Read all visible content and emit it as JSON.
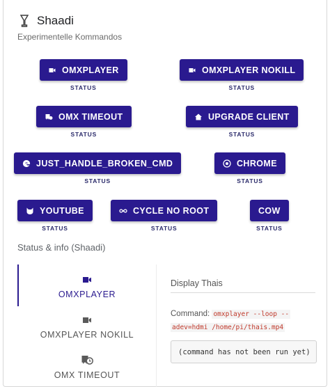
{
  "header": {
    "icon": "cocktail-glass-icon",
    "title": "Shaadi",
    "subtitle": "Experimentelle Kommandos"
  },
  "commands": [
    {
      "label": "OMXPLAYER",
      "status": "STATUS",
      "icon": "video-camera-icon"
    },
    {
      "label": "OMXPLAYER NOKILL",
      "status": "STATUS",
      "icon": "video-camera-icon"
    },
    {
      "label": "OMX TIMEOUT",
      "status": "STATUS",
      "icon": "bus-clock-icon"
    },
    {
      "label": "UPGRADE CLIENT",
      "status": "STATUS",
      "icon": "home-icon"
    },
    {
      "label": "JUST_HANDLE_BROKEN_CMD",
      "status": "STATUS",
      "icon": "edge-browser-icon"
    },
    {
      "label": "CHROME",
      "status": "STATUS",
      "icon": "chrome-icon"
    },
    {
      "label": "YOUTUBE",
      "status": "STATUS",
      "icon": "cat-icon"
    },
    {
      "label": "CYCLE NO ROOT",
      "status": "STATUS",
      "icon": "infinity-icon"
    },
    {
      "label": "COW",
      "status": "STATUS",
      "icon": ""
    }
  ],
  "status_section": {
    "title": "Status & info (Shaadi)",
    "tabs": [
      {
        "label": "OMXPLAYER",
        "icon": "video-camera-icon",
        "active": true
      },
      {
        "label": "OMXPLAYER NOKILL",
        "icon": "video-camera-icon",
        "active": false
      },
      {
        "label": "OMX TIMEOUT",
        "icon": "bus-clock-icon",
        "active": false
      }
    ],
    "panel": {
      "title": "Display Thais",
      "command_label": "Command:",
      "command_code_1": "omxplayer --loop --",
      "command_code_2": "adev=hdmi /home/pi/thais.mp4",
      "output": "(command has not been run yet)"
    }
  },
  "colors": {
    "accent": "#2a1a8f",
    "code_text": "#c0392b"
  }
}
